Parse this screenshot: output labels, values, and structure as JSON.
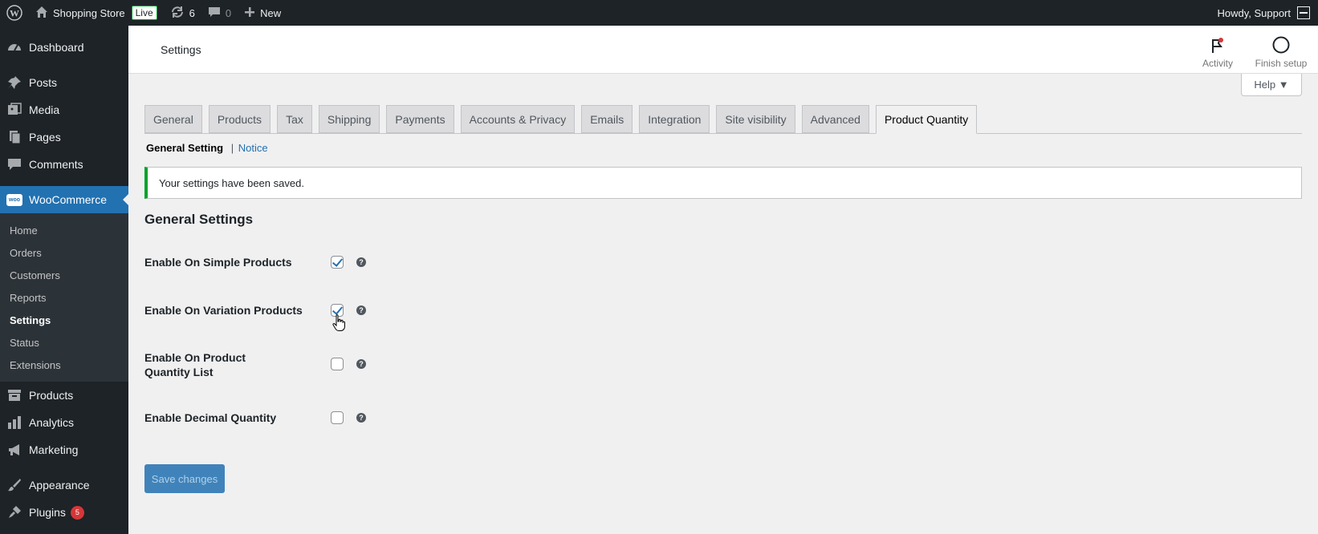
{
  "adminbar": {
    "wp_logo_icon": "wordpress-icon",
    "site_name": "Shopping Store",
    "live_label": "Live",
    "updates_count": "6",
    "comments_count": "0",
    "new_label": "New",
    "howdy": "Howdy, Support"
  },
  "sidebar": {
    "top_items": [
      {
        "label": "Dashboard",
        "icon": "dashboard-icon"
      },
      {
        "label": "Posts",
        "icon": "pin-icon"
      },
      {
        "label": "Media",
        "icon": "media-icon"
      },
      {
        "label": "Pages",
        "icon": "pages-icon"
      },
      {
        "label": "Comments",
        "icon": "comment-icon"
      }
    ],
    "woocommerce": {
      "label": "WooCommerce",
      "icon_text": "woo"
    },
    "woo_submenu": [
      "Home",
      "Orders",
      "Customers",
      "Reports",
      "Settings",
      "Status",
      "Extensions"
    ],
    "bottom_items": [
      {
        "label": "Products",
        "icon": "archive-icon"
      },
      {
        "label": "Analytics",
        "icon": "bar-chart-icon"
      },
      {
        "label": "Marketing",
        "icon": "megaphone-icon"
      },
      {
        "label": "Appearance",
        "icon": "brush-icon"
      },
      {
        "label": "Plugins",
        "icon": "plugin-icon",
        "badge": "5"
      }
    ]
  },
  "header": {
    "title": "Settings",
    "activity_label": "Activity",
    "finish_label": "Finish setup"
  },
  "help": {
    "label": "Help ▼"
  },
  "tabs": [
    "General",
    "Products",
    "Tax",
    "Shipping",
    "Payments",
    "Accounts & Privacy",
    "Emails",
    "Integration",
    "Site visibility",
    "Advanced",
    "Product Quantity"
  ],
  "active_tab": "Product Quantity",
  "subsub": {
    "current": "General Setting",
    "separator": "|",
    "link": "Notice"
  },
  "notice": {
    "text": "Your settings have been saved."
  },
  "section": {
    "title": "General Settings"
  },
  "settings": [
    {
      "label": "Enable On Simple Products",
      "checked": true
    },
    {
      "label": "Enable On Variation Products",
      "checked": true
    },
    {
      "label": "Enable On Product Quantity List",
      "checked": false
    },
    {
      "label": "Enable Decimal Quantity",
      "checked": false
    }
  ],
  "tip_glyph": "?",
  "save_button": {
    "label": "Save changes"
  },
  "colors": {
    "accent": "#2271b1",
    "adminbar": "#1d2327",
    "success": "#00a32a",
    "badge": "#d63638"
  }
}
